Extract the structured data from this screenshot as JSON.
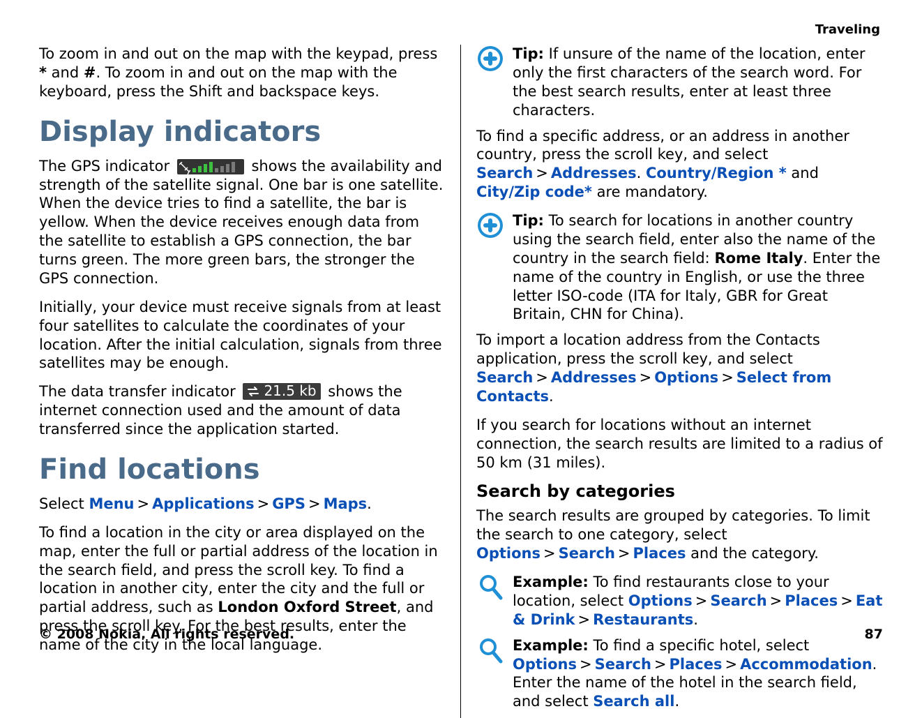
{
  "header": {
    "section": "Traveling"
  },
  "left": {
    "p_zoom_pre": "To zoom in and out on the map with the keypad, press ",
    "star": "*",
    "and": " and ",
    "hash": "#",
    "p_zoom_post": ". To zoom in and out on the map with the keyboard, press the Shift and backspace keys.",
    "h_display": "Display indicators",
    "gps_pre": "The GPS indicator ",
    "gps_post": " shows the availability and strength of the satellite signal. One bar is one satellite. When the device tries to find a satellite, the bar is yellow. When the device receives enough data from the satellite to establish a GPS connection, the bar turns green. The more green bars, the stronger the GPS connection.",
    "gps_initial": "Initially, your device must receive signals from at least four satellites to calculate the coordinates of your location. After the initial calculation, signals from three satellites may be enough.",
    "dt_pre": "The data transfer indicator ",
    "dt_value": "21.5 kb",
    "dt_post": " shows the internet connection used and the amount of data transferred since the application started.",
    "h_find": "Find locations",
    "nav_select": "Select ",
    "nav_menu": "Menu",
    "nav_apps": "Applications",
    "nav_gps": "GPS",
    "nav_maps": "Maps",
    "find_p_pre": "To find a location in the city or area displayed on the map, enter the full or partial address of the location in the search field, and press the scroll key. To find a location in another city, enter the city and the full or partial address, such as ",
    "find_example": "London Oxford Street",
    "find_p_post": ", and press the scroll key. For the best results, enter the name of the city in the local language."
  },
  "right": {
    "tip1_label": "Tip:",
    "tip1_text": " If unsure of the name of the location, enter only the first characters of the search word. For the best search results, enter at least three characters.",
    "addr_pre": "To find a specific address, or an address in another country, press the scroll key, and select ",
    "addr_search": "Search",
    "addr_addresses": "Addresses",
    "addr_dot": ". ",
    "addr_country": "Country/Region *",
    "addr_and": " and ",
    "addr_city": "City/Zip code*",
    "addr_post": " are mandatory.",
    "tip2_label": "Tip:",
    "tip2_pre": " To search for locations in another country using the search field, enter also the name of the country in the search field: ",
    "tip2_bold": "Rome Italy",
    "tip2_post": ". Enter the name of the country in English, or use the three letter ISO-code (ITA for Italy, GBR for Great Britain, CHN for China).",
    "import_pre": "To import a location address from the Contacts application, press the scroll key, and select ",
    "import_search": "Search",
    "import_addresses": "Addresses",
    "import_options": "Options",
    "import_select": "Select from Contacts",
    "offline": "If you search for locations without an internet connection, the search results are limited to a radius of 50 km (31 miles).",
    "h_searchcat": "Search by categories",
    "cat_pre": "The search results are grouped by categories. To limit the search to one category, select ",
    "cat_options": "Options",
    "cat_search": "Search",
    "cat_places": "Places",
    "cat_post": " and the category.",
    "ex1_label": "Example:",
    "ex1_pre": " To find restaurants close to your location, select ",
    "ex1_options": "Options",
    "ex1_search": "Search",
    "ex1_places": "Places",
    "ex1_eat": "Eat & Drink",
    "ex1_rest": "Restaurants",
    "ex2_label": "Example:",
    "ex2_pre": " To find a specific hotel, select ",
    "ex2_options": "Options",
    "ex2_search": "Search",
    "ex2_places": "Places",
    "ex2_acc": "Accommodation",
    "ex2_mid": ". Enter the name of the hotel in the search field, and select ",
    "ex2_searchall": "Search all",
    "dot": "."
  },
  "footer": {
    "copyright": "© 2008 Nokia. All rights reserved.",
    "page": "87"
  },
  "gt": ">"
}
